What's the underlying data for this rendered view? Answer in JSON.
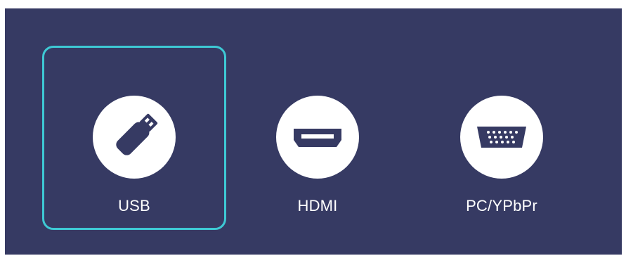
{
  "sources": [
    {
      "label": "USB",
      "icon": "usb-drive-icon",
      "selected": true
    },
    {
      "label": "HDMI",
      "icon": "hdmi-port-icon",
      "selected": false
    },
    {
      "label": "PC/YPbPr",
      "icon": "vga-port-icon",
      "selected": false
    }
  ],
  "colors": {
    "background": "#363a63",
    "selection_border": "#3ec9d4",
    "icon_circle": "#ffffff",
    "icon_fill": "#363a63",
    "label": "#ffffff"
  }
}
